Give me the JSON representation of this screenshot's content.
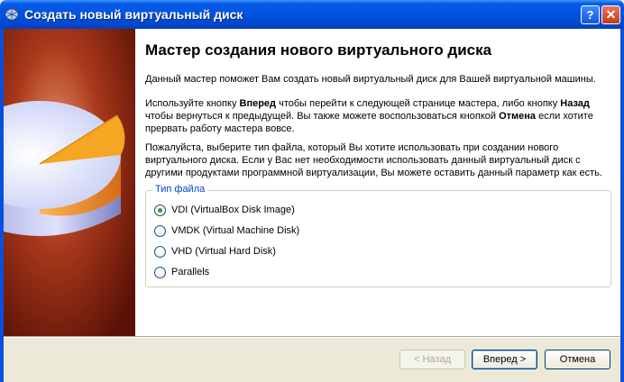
{
  "window": {
    "title": "Создать новый виртуальный диск",
    "help_label": "?",
    "close_label": "✕"
  },
  "wizard": {
    "heading": "Мастер создания нового виртуального диска",
    "p1": "Данный мастер поможет Вам создать новый виртуальный диск для Вашей виртуальной машины.",
    "p2": {
      "t1": "Используйте кнопку ",
      "b1": "Вперед",
      "t2": " чтобы перейти к следующей странице мастера, либо кнопку ",
      "b2": "Назад",
      "t3": " чтобы вернуться к предыдущей. Вы также можете воспользоваться кнопкой ",
      "b3": "Отмена",
      "t4": " если хотите прервать работу мастера вовсе."
    },
    "p3": "Пожалуйста, выберите тип файла, который Вы хотите использовать при создании нового виртуального диска. Если у Вас нет необходимости использовать данный виртуальный диск с другими продуктами программной виртуализации, Вы можете оставить данный параметр как есть."
  },
  "file_type": {
    "legend": "Тип файла",
    "selected_index": 0,
    "options": [
      {
        "label": "VDI (VirtualBox Disk Image)"
      },
      {
        "label": "VMDK (Virtual Machine Disk)"
      },
      {
        "label": "VHD (Virtual Hard Disk)"
      },
      {
        "label": "Parallels"
      }
    ]
  },
  "buttons": {
    "back": "< Назад",
    "next": "Вперед >",
    "cancel": "Отмена"
  },
  "colors": {
    "titlebar": "#0054e3",
    "legend": "#0046d5",
    "image_background": "#7d1c0a",
    "disk_slice": "#f5a623"
  },
  "icons": {
    "app": "virtualbox-icon",
    "image": "hard-disk-illustration"
  }
}
